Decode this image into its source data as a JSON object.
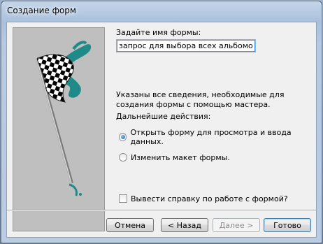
{
  "window": {
    "title": "Создание форм"
  },
  "wizard": {
    "name_label": "Задайте имя формы:",
    "name_value": "запрос для выбора всех альбомов на плас",
    "info_text": "Указаны все сведения, необходимые для создания формы с помощью мастера.",
    "next_actions_label": "Дальнейшие действия:",
    "options": [
      {
        "label": "Открыть форму для просмотра и ввода данных.",
        "selected": true
      },
      {
        "label": "Изменить макет формы.",
        "selected": false
      }
    ],
    "help_checkbox": {
      "label": "Вывести справку по работе с формой?",
      "checked": false
    }
  },
  "buttons": {
    "cancel": "Отмена",
    "back": "< Назад",
    "next": "Далее >",
    "finish": "Готово"
  },
  "colors": {
    "flag_ribbon": "#1f8a88",
    "panel_bg": "#bfbfbf"
  },
  "icons": {
    "picture": "checkered-flag-icon"
  }
}
